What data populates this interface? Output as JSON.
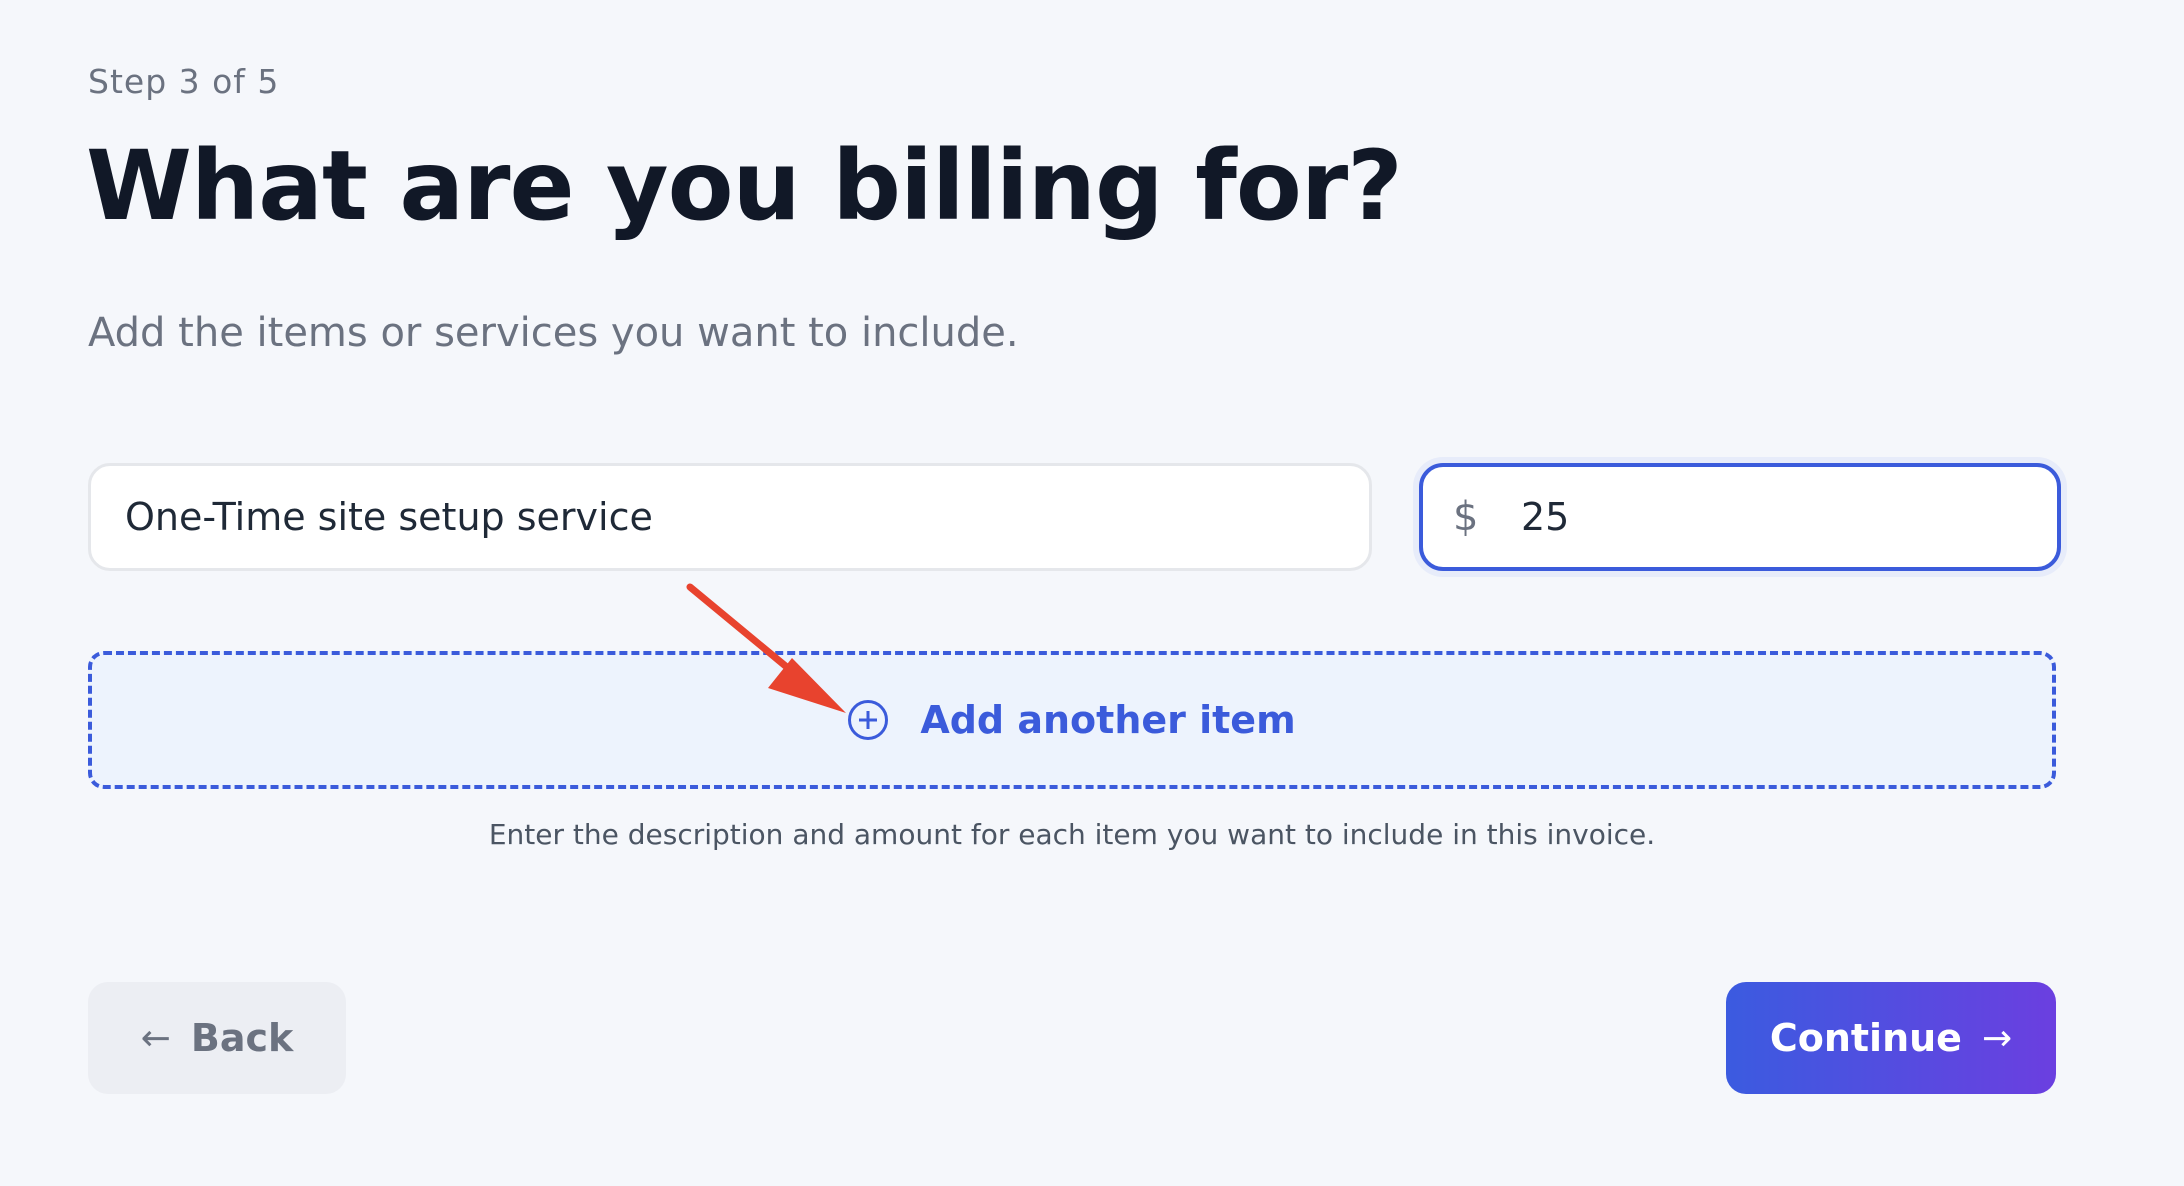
{
  "header": {
    "step": "Step 3 of 5",
    "title": "What are you billing for?",
    "subtitle": "Add the items or services you want to include."
  },
  "item": {
    "description_value": "One-Time site setup service",
    "currency_symbol": "$",
    "amount_value": "25"
  },
  "add_item": {
    "label": "Add another item",
    "icon": "plus-circle-icon"
  },
  "helper_text": "Enter the description and amount for each item you want to include in this invoice.",
  "annotation": {
    "color": "#e8432e"
  },
  "footer": {
    "back_label": "Back",
    "back_icon": "arrow-left-icon",
    "continue_label": "Continue",
    "continue_icon": "arrow-right-icon"
  },
  "colors": {
    "accent": "#3b5bdb",
    "background": "#f5f7fb",
    "title": "#111827"
  }
}
